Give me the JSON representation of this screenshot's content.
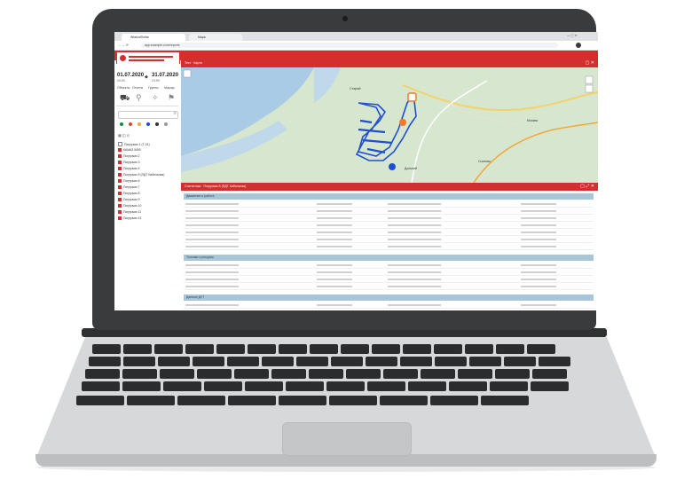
{
  "browser": {
    "tabs": [
      "Wialon/Dollar",
      "Mapa"
    ],
    "url": "app.example.com/reports"
  },
  "app": {
    "date_from": "01.07.2020",
    "date_to": "31.07.2020",
    "time_from": "00:00",
    "time_to": "23:59",
    "tool_labels": [
      "Объекты",
      "Отчеты",
      "Группы",
      "Маршр."
    ],
    "units": [
      "Погрузчик 1 (Т-01)",
      "КАМАЗ 5490",
      "Погрузчик 2",
      "Погрузчик 3",
      "Погрузчик 4",
      "Погрузчик 5 (ПДТ Кабельная)",
      "Погрузчик 6",
      "Погрузчик 7",
      "Погрузчик 8",
      "Погрузчик 9",
      "Погрузчик 10",
      "Погрузчик 11",
      "Погрузчик 12"
    ],
    "map_header": "Тест · Карта",
    "report_header": "Статистика · Погрузчик 5 (ПДТ Кабельная)",
    "sections": [
      "Движение и работа",
      "Топливо и ресурсы",
      "Данные ДУТ"
    ],
    "map_labels": [
      "Старый",
      "Дольний",
      "Москва",
      "Сосново"
    ]
  },
  "colors": {
    "brand_red": "#d32f2f",
    "map_green": "#d6e6cf",
    "water": "#a9cbe6",
    "track_blue": "#1f4fd1",
    "marker_orange": "#f07a2b"
  }
}
